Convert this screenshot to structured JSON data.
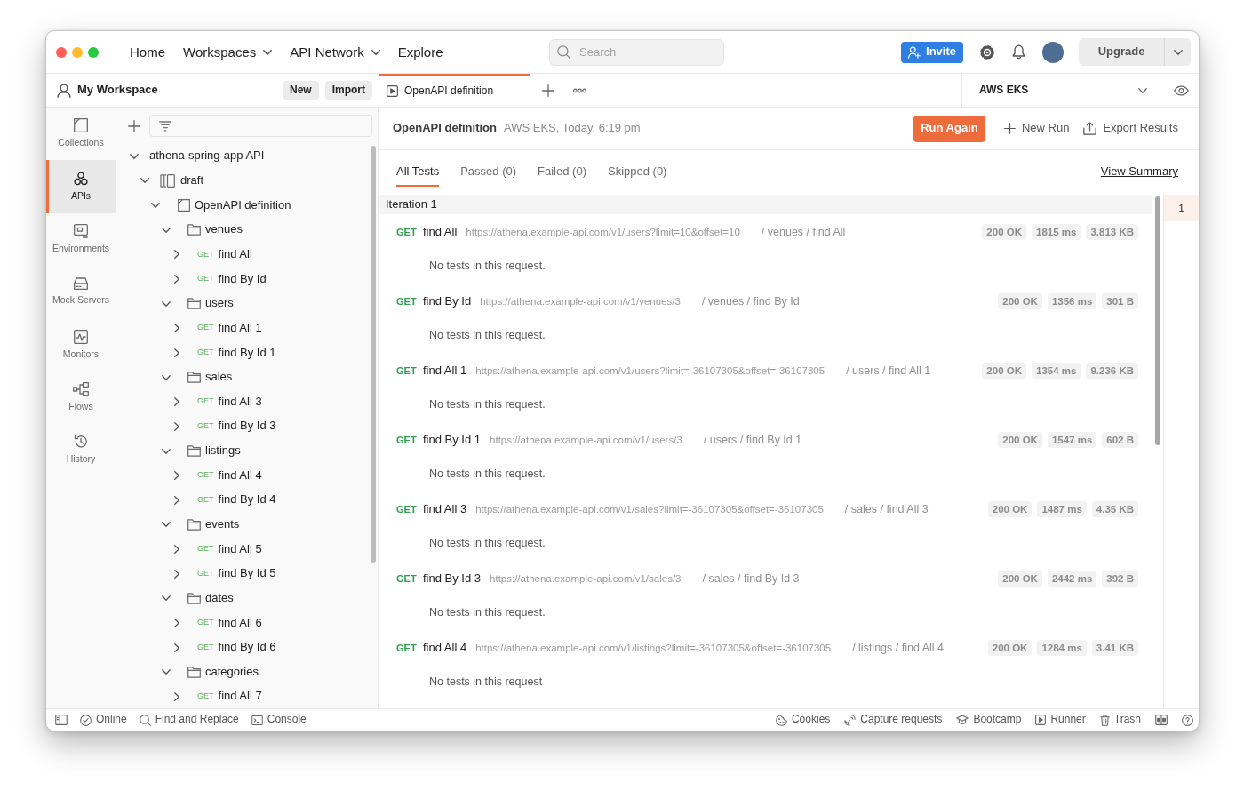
{
  "top_nav": {
    "links": [
      {
        "label": "Home",
        "dropdown": false
      },
      {
        "label": "Workspaces",
        "dropdown": true
      },
      {
        "label": "API Network",
        "dropdown": true
      },
      {
        "label": "Explore",
        "dropdown": false
      }
    ],
    "search": {
      "placeholder": "Search"
    },
    "invite_button": "Invite",
    "upgrade_button": "Upgrade"
  },
  "workspace": {
    "title": "My Workspace",
    "buttons": [
      "New",
      "Import"
    ]
  },
  "tabs": [
    {
      "label": "OpenAPI definition",
      "selected": true
    }
  ],
  "environment": {
    "name": "AWS EKS"
  },
  "sidebar": {
    "items": [
      {
        "label": "Collections",
        "selected": false
      },
      {
        "label": "APIs",
        "selected": true
      },
      {
        "label": "Environments",
        "selected": false
      },
      {
        "label": "Mock Servers",
        "selected": false
      },
      {
        "label": "Monitors",
        "selected": false
      },
      {
        "label": "Flows",
        "selected": false
      },
      {
        "label": "History",
        "selected": false
      }
    ]
  },
  "tree": {
    "items": [
      {
        "kind": "api",
        "label": "athena-spring-app API",
        "expanded": true,
        "children": [
          {
            "kind": "version",
            "label": "draft",
            "expanded": true,
            "children": [
              {
                "kind": "definition",
                "label": "OpenAPI definition",
                "expanded": true,
                "children": [
                  {
                    "kind": "folder",
                    "label": "venues",
                    "expanded": true,
                    "children": [
                      {
                        "kind": "request",
                        "method": "GET",
                        "label": "find All",
                        "expanded": false
                      },
                      {
                        "kind": "request",
                        "method": "GET",
                        "label": "find By Id",
                        "expanded": false
                      }
                    ]
                  },
                  {
                    "kind": "folder",
                    "label": "users",
                    "expanded": true,
                    "children": [
                      {
                        "kind": "request",
                        "method": "GET",
                        "label": "find All 1",
                        "expanded": false
                      },
                      {
                        "kind": "request",
                        "method": "GET",
                        "label": "find By Id 1",
                        "expanded": false
                      }
                    ]
                  },
                  {
                    "kind": "folder",
                    "label": "sales",
                    "expanded": true,
                    "children": [
                      {
                        "kind": "request",
                        "method": "GET",
                        "label": "find All 3",
                        "expanded": false
                      },
                      {
                        "kind": "request",
                        "method": "GET",
                        "label": "find By Id 3",
                        "expanded": false
                      }
                    ]
                  },
                  {
                    "kind": "folder",
                    "label": "listings",
                    "expanded": true,
                    "children": [
                      {
                        "kind": "request",
                        "method": "GET",
                        "label": "find All 4",
                        "expanded": false
                      },
                      {
                        "kind": "request",
                        "method": "GET",
                        "label": "find By Id 4",
                        "expanded": false
                      }
                    ]
                  },
                  {
                    "kind": "folder",
                    "label": "events",
                    "expanded": true,
                    "children": [
                      {
                        "kind": "request",
                        "method": "GET",
                        "label": "find All 5",
                        "expanded": false
                      },
                      {
                        "kind": "request",
                        "method": "GET",
                        "label": "find By Id 5",
                        "expanded": false
                      }
                    ]
                  },
                  {
                    "kind": "folder",
                    "label": "dates",
                    "expanded": true,
                    "children": [
                      {
                        "kind": "request",
                        "method": "GET",
                        "label": "find All 6",
                        "expanded": false
                      },
                      {
                        "kind": "request",
                        "method": "GET",
                        "label": "find By Id 6",
                        "expanded": false
                      }
                    ]
                  },
                  {
                    "kind": "folder",
                    "label": "categories",
                    "expanded": true,
                    "children": [
                      {
                        "kind": "request",
                        "method": "GET",
                        "label": "find All 7",
                        "expanded": false
                      }
                    ]
                  }
                ]
              }
            ]
          }
        ]
      }
    ]
  },
  "run": {
    "title": "OpenAPI definition",
    "meta": "AWS EKS, Today, 6:19 pm",
    "run_again_button": "Run Again",
    "new_run_button": "New Run",
    "export_button": "Export Results"
  },
  "result_tabs": [
    {
      "label": "All Tests",
      "selected": true
    },
    {
      "label": "Passed (0)",
      "selected": false
    },
    {
      "label": "Failed (0)",
      "selected": false
    },
    {
      "label": "Skipped (0)",
      "selected": false
    }
  ],
  "view_summary_link": "View Summary",
  "iteration": {
    "title": "Iteration 1",
    "results": [
      {
        "method": "GET",
        "name": "find All",
        "url": "https://athena.example-api.com/v1/users?limit=10&offset=10",
        "path": "/ venues / find All",
        "status": "200 OK",
        "time": "1815 ms",
        "size": "3.813 KB",
        "message": "No tests in this request."
      },
      {
        "method": "GET",
        "name": "find By Id",
        "url": "https://athena.example-api.com/v1/venues/3",
        "path": "/ venues / find By Id",
        "status": "200 OK",
        "time": "1356 ms",
        "size": "301 B",
        "message": "No tests in this request."
      },
      {
        "method": "GET",
        "name": "find All 1",
        "url": "https://athena.example-api.com/v1/users?limit=-36107305&offset=-36107305",
        "path": "/ users / find All 1",
        "status": "200 OK",
        "time": "1354 ms",
        "size": "9.236 KB",
        "message": "No tests in this request."
      },
      {
        "method": "GET",
        "name": "find By Id 1",
        "url": "https://athena.example-api.com/v1/users/3",
        "path": "/ users / find By Id 1",
        "status": "200 OK",
        "time": "1547 ms",
        "size": "602 B",
        "message": "No tests in this request."
      },
      {
        "method": "GET",
        "name": "find All 3",
        "url": "https://athena.example-api.com/v1/sales?limit=-36107305&offset=-36107305",
        "path": "/ sales / find All 3",
        "status": "200 OK",
        "time": "1487 ms",
        "size": "4.35 KB",
        "message": "No tests in this request."
      },
      {
        "method": "GET",
        "name": "find By Id 3",
        "url": "https://athena.example-api.com/v1/sales/3",
        "path": "/ sales / find By Id 3",
        "status": "200 OK",
        "time": "2442 ms",
        "size": "392 B",
        "message": "No tests in this request."
      },
      {
        "method": "GET",
        "name": "find All 4",
        "url": "https://athena.example-api.com/v1/listings?limit=-36107305&offset=-36107305",
        "path": "/ listings / find All 4",
        "status": "200 OK",
        "time": "1284 ms",
        "size": "3.41 KB",
        "message": "No tests in this request"
      }
    ]
  },
  "iterations": [
    {
      "label": "1",
      "selected": true
    }
  ],
  "status_bar": {
    "left": [
      "Online",
      "Find and Replace",
      "Console"
    ],
    "right": [
      "Cookies",
      "Capture requests",
      "Bootcamp",
      "Runner",
      "Trash"
    ]
  }
}
